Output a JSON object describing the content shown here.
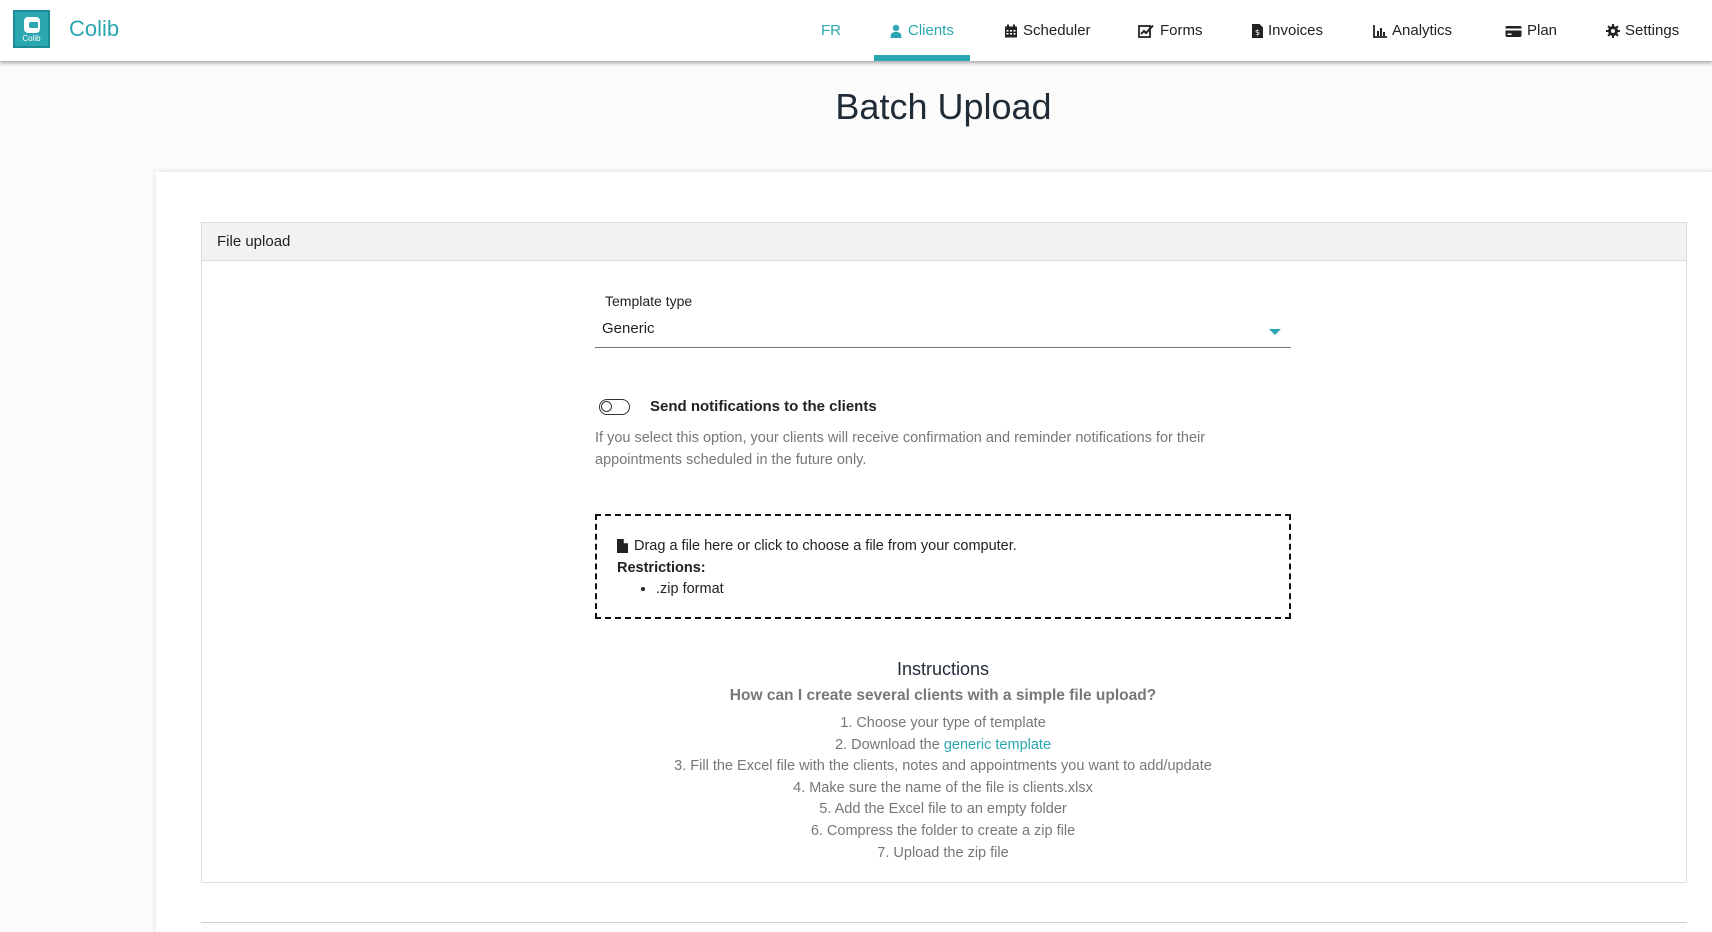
{
  "brand": {
    "name": "Colib",
    "logo_text": "Colib"
  },
  "nav": {
    "lang": "FR",
    "items": [
      {
        "label": "Clients",
        "icon": "user-icon",
        "active": true
      },
      {
        "label": "Scheduler",
        "icon": "calendar-icon"
      },
      {
        "label": "Forms",
        "icon": "signature-icon"
      },
      {
        "label": "Invoices",
        "icon": "invoice-icon"
      },
      {
        "label": "Analytics",
        "icon": "chart-icon"
      },
      {
        "label": "Plan",
        "icon": "credit-card-icon"
      },
      {
        "label": "Settings",
        "icon": "gear-icon"
      }
    ]
  },
  "page": {
    "title": "Batch Upload"
  },
  "panel": {
    "header": "File upload"
  },
  "template": {
    "label": "Template type",
    "value": "Generic"
  },
  "notifications": {
    "label": "Send notifications to the clients",
    "enabled": false,
    "description": "If you select this option, your clients will receive confirmation and reminder notifications for their appointments scheduled in the future only."
  },
  "dropzone": {
    "text": "Drag a file here or click to choose a file from your computer.",
    "restrictions_label": "Restrictions:",
    "restrictions": [
      ".zip format"
    ]
  },
  "instructions": {
    "title": "Instructions",
    "question": "How can I create several clients with a simple file upload?",
    "step1": "1. Choose your type of template",
    "step2_prefix": "2. Download the ",
    "step2_link": "generic template",
    "step3": "3. Fill the Excel file with the clients, notes and appointments you want to add/update",
    "step4": "4. Make sure the name of the file is clients.xlsx",
    "step5": "5. Add the Excel file to an empty folder",
    "step6": "6. Compress the folder to create a zip file",
    "step7": "7. Upload the zip file"
  },
  "colors": {
    "accent": "#2aa7b0",
    "text": "#222222",
    "muted": "#777777"
  }
}
